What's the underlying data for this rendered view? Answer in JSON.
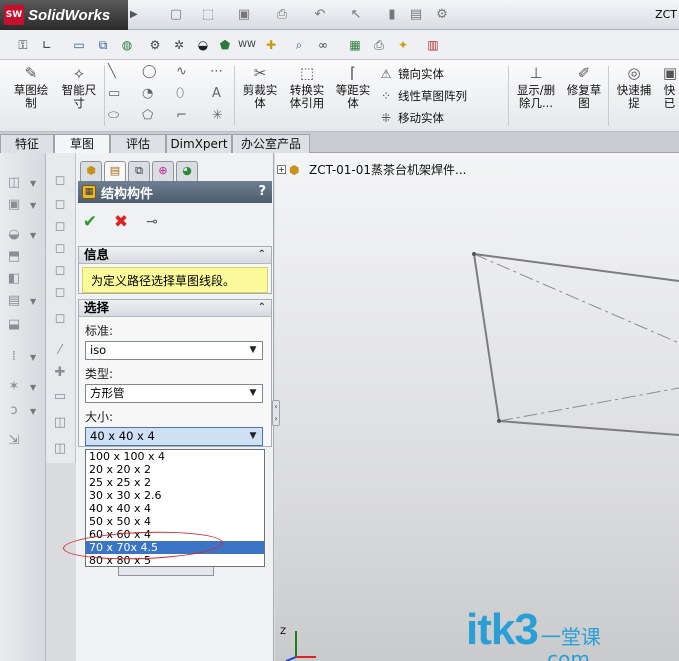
{
  "app": {
    "name": "SolidWorks",
    "logo_mark": "SW",
    "doc_title": "ZCT"
  },
  "ribbon": {
    "sketch_big": [
      {
        "label": "草图绘\n制",
        "icon": "sketch-icon"
      },
      {
        "label": "智能尺\n寸",
        "icon": "smart-dimension-icon"
      }
    ],
    "edit_big": [
      {
        "label": "剪裁实\n体",
        "icon": "trim-icon"
      },
      {
        "label": "转换实\n体引用",
        "icon": "convert-entities-icon"
      },
      {
        "label": "等距实\n体",
        "icon": "offset-icon"
      }
    ],
    "edit_small": [
      {
        "label": "镜向实体",
        "icon": "mirror-icon"
      },
      {
        "label": "线性草图阵列",
        "icon": "linear-pattern-icon"
      },
      {
        "label": "移动实体",
        "icon": "move-icon"
      }
    ],
    "relations_big": [
      {
        "label": "显示/删\n除几...",
        "icon": "relations-icon"
      },
      {
        "label": "修复草\n图",
        "icon": "repair-icon"
      },
      {
        "label": "快速捕\n捉",
        "icon": "snap-icon"
      },
      {
        "label": "快\n已",
        "icon": "quick-icon"
      }
    ]
  },
  "tabs": [
    {
      "label": "特征",
      "active": false
    },
    {
      "label": "草图",
      "active": true
    },
    {
      "label": "评估",
      "active": false
    },
    {
      "label": "DimXpert",
      "active": false
    },
    {
      "label": "办公室产品",
      "active": false
    }
  ],
  "property_manager": {
    "title": "结构构件",
    "help": "?",
    "info": {
      "header": "信息",
      "message": "为定义路径选择草图线段。"
    },
    "selection": {
      "header": "选择",
      "standard_label": "标准:",
      "standard_value": "iso",
      "type_label": "类型:",
      "type_value": "方形管",
      "size_label": "大小:",
      "size_value": "40 x 40 x 4",
      "size_options": [
        "100 x 100 x 4",
        "20 x 20 x 2",
        "25 x 25 x 2",
        "30 x 30 x 2.6",
        "40 x 40 x 4",
        "50 x 50 x 4",
        "60 x 60 x 4",
        "70 x 70x 4.5",
        "80 x 80 x 5"
      ],
      "highlighted_option": 7
    }
  },
  "graphics": {
    "tree_root": "ZCT-01-01蒸茶台机架焊件...",
    "triad_axis_label": "Z"
  },
  "watermark": {
    "main": "itk3",
    "side_top": "一堂课",
    "side_bottom": ".com"
  }
}
